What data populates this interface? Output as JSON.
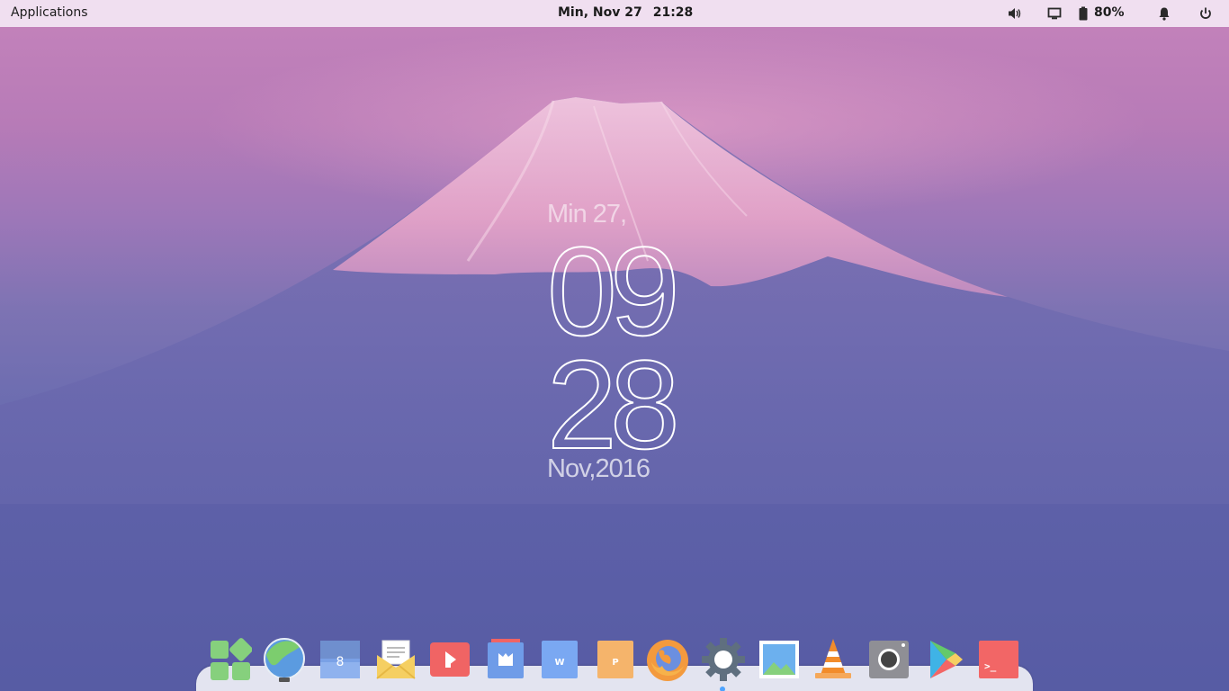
{
  "top_panel": {
    "applications_label": "Applications",
    "date": "Min, Nov 27",
    "time": "21:28",
    "battery_percent": "80%",
    "tray_icons": [
      "volume-icon",
      "display-icon",
      "battery-icon",
      "notifications-bell-icon",
      "power-icon"
    ]
  },
  "clock_widget": {
    "day": "Min 27,",
    "hour": "09",
    "minute": "28",
    "month_year": "Nov,2016"
  },
  "dock": {
    "items": [
      {
        "icon": "app-launcher-icon",
        "color": "#86d07d"
      },
      {
        "icon": "web-browser-globe-icon",
        "color": "#6aa7e8"
      },
      {
        "icon": "calendar-icon",
        "color": "#7aa1e6",
        "text": "8"
      },
      {
        "icon": "mail-icon",
        "color": "#f5cf62"
      },
      {
        "icon": "media-player-icon",
        "color": "#f06464"
      },
      {
        "icon": "files-icon",
        "color": "#6f9ce8"
      },
      {
        "icon": "writer-document-icon",
        "color": "#7aa8f2",
        "text": "W"
      },
      {
        "icon": "presentation-icon",
        "color": "#f5b46b",
        "text": "P"
      },
      {
        "icon": "firefox-icon",
        "color": "#f39a3e"
      },
      {
        "icon": "settings-gear-icon",
        "color": "#5f6f7f"
      },
      {
        "icon": "image-viewer-icon",
        "color": "#6cb0ee"
      },
      {
        "icon": "vlc-cone-icon",
        "color": "#f28c2b"
      },
      {
        "icon": "camera-icon",
        "color": "#8f8f95"
      },
      {
        "icon": "play-store-icon",
        "color": "#3fb3e6"
      },
      {
        "icon": "terminal-icon",
        "color": "#f26666",
        "text": ">_"
      }
    ],
    "active_indicator_color": "#4da3ff"
  },
  "colors": {
    "panel_background": "#f0dff0",
    "dock_background": "#e3e4f0"
  }
}
